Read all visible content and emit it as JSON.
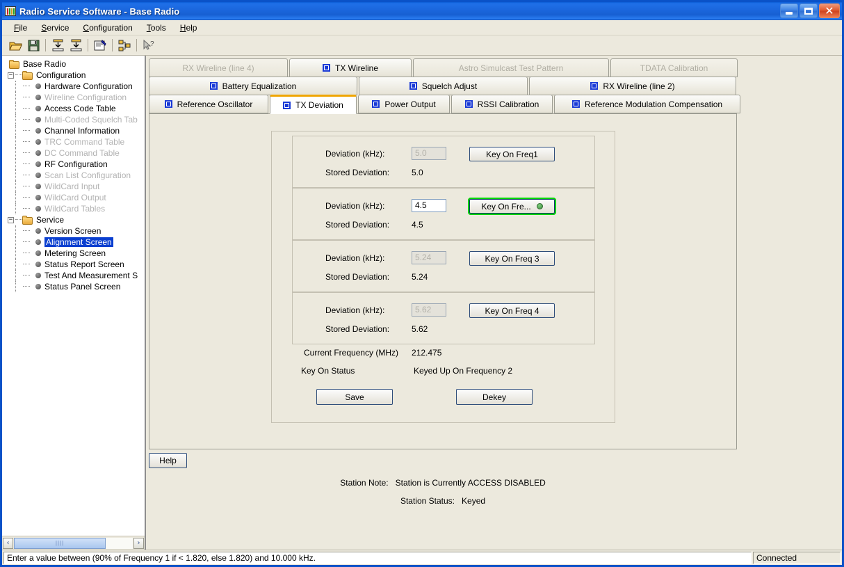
{
  "window": {
    "title": "Radio Service Software - Base Radio",
    "icon": "radio-icon",
    "minimize_label": "Minimize",
    "maximize_label": "Maximize",
    "close_label": "Close"
  },
  "menu": [
    {
      "label": "File",
      "accel": "F"
    },
    {
      "label": "Service",
      "accel": "S"
    },
    {
      "label": "Configuration",
      "accel": "C"
    },
    {
      "label": "Tools",
      "accel": "T"
    },
    {
      "label": "Help",
      "accel": "H"
    }
  ],
  "toolbar": [
    {
      "name": "open-icon",
      "title": "Open"
    },
    {
      "name": "save-icon",
      "title": "Save"
    },
    {
      "sep": true
    },
    {
      "name": "read-from-radio-icon",
      "title": "Read from radio"
    },
    {
      "name": "write-to-radio-icon",
      "title": "Write to radio"
    },
    {
      "sep": true
    },
    {
      "name": "report-icon",
      "title": "Report"
    },
    {
      "sep": true
    },
    {
      "name": "network-icon",
      "title": "Network"
    },
    {
      "sep": true
    },
    {
      "name": "help-pointer-icon",
      "title": "Context help"
    }
  ],
  "tree": {
    "root": {
      "label": "Base Radio",
      "icon": "folder-icon"
    },
    "nodes": [
      {
        "label": "Configuration",
        "type": "folder",
        "expanded": true,
        "depth": 1,
        "disabled": false
      },
      {
        "label": "Hardware Configuration",
        "type": "leaf",
        "depth": 2,
        "disabled": false
      },
      {
        "label": "Wireline Configuration",
        "type": "leaf",
        "depth": 2,
        "disabled": true
      },
      {
        "label": "Access Code Table",
        "type": "leaf",
        "depth": 2,
        "disabled": false
      },
      {
        "label": "Multi-Coded Squelch Tab",
        "type": "leaf",
        "depth": 2,
        "disabled": true
      },
      {
        "label": "Channel Information",
        "type": "leaf",
        "depth": 2,
        "disabled": false
      },
      {
        "label": "TRC Command Table",
        "type": "leaf",
        "depth": 2,
        "disabled": true
      },
      {
        "label": "DC Command Table",
        "type": "leaf",
        "depth": 2,
        "disabled": true
      },
      {
        "label": "RF Configuration",
        "type": "leaf",
        "depth": 2,
        "disabled": false
      },
      {
        "label": "Scan List Configuration",
        "type": "leaf",
        "depth": 2,
        "disabled": true
      },
      {
        "label": "WildCard Input",
        "type": "leaf",
        "depth": 2,
        "disabled": true
      },
      {
        "label": "WildCard Output",
        "type": "leaf",
        "depth": 2,
        "disabled": true
      },
      {
        "label": "WildCard Tables",
        "type": "leaf",
        "depth": 2,
        "disabled": true
      },
      {
        "label": "Service",
        "type": "folder",
        "expanded": true,
        "depth": 1,
        "disabled": false
      },
      {
        "label": "Version Screen",
        "type": "leaf",
        "depth": 2,
        "disabled": false
      },
      {
        "label": "Alignment Screen",
        "type": "leaf",
        "depth": 2,
        "disabled": false,
        "selected": true
      },
      {
        "label": "Metering Screen",
        "type": "leaf",
        "depth": 2,
        "disabled": false
      },
      {
        "label": "Status Report Screen",
        "type": "leaf",
        "depth": 2,
        "disabled": false
      },
      {
        "label": "Test And Measurement S",
        "type": "leaf",
        "depth": 2,
        "disabled": false
      },
      {
        "label": "Status Panel Screen",
        "type": "leaf",
        "depth": 2,
        "disabled": false
      }
    ]
  },
  "tabs": {
    "row1": [
      {
        "label": "RX Wireline (line 4)",
        "disabled": true,
        "active": false
      },
      {
        "label": "TX Wireline",
        "disabled": false,
        "active": false
      },
      {
        "label": "Astro Simulcast Test Pattern",
        "disabled": true,
        "active": false
      },
      {
        "label": "TDATA Calibration",
        "disabled": true,
        "active": false
      }
    ],
    "row2": [
      {
        "label": "Battery Equalization",
        "disabled": false,
        "active": false
      },
      {
        "label": "Squelch Adjust",
        "disabled": false,
        "active": false
      },
      {
        "label": "RX Wireline (line 2)",
        "disabled": false,
        "active": false
      }
    ],
    "row3": [
      {
        "label": "Reference Oscillator",
        "disabled": false,
        "active": false
      },
      {
        "label": "TX Deviation",
        "disabled": false,
        "active": true
      },
      {
        "label": "Power Output",
        "disabled": false,
        "active": false
      },
      {
        "label": "RSSI Calibration",
        "disabled": false,
        "active": false
      },
      {
        "label": "Reference Modulation Compensation",
        "disabled": false,
        "active": false
      }
    ]
  },
  "deviation_groups": [
    {
      "deviation_label": "Deviation (kHz):",
      "value": "5.0",
      "enabled": false,
      "stored_label": "Stored Deviation:",
      "stored_value": "5.0",
      "button_label": "Key On Freq1",
      "keyed": false
    },
    {
      "deviation_label": "Deviation (kHz):",
      "value": "4.5",
      "enabled": true,
      "stored_label": "Stored Deviation:",
      "stored_value": "4.5",
      "button_label": "Key On Fre...",
      "keyed": true
    },
    {
      "deviation_label": "Deviation (kHz):",
      "value": "5.24",
      "enabled": false,
      "stored_label": "Stored Deviation:",
      "stored_value": "5.24",
      "button_label": "Key On Freq 3",
      "keyed": false
    },
    {
      "deviation_label": "Deviation (kHz):",
      "value": "5.62",
      "enabled": false,
      "stored_label": "Stored Deviation:",
      "stored_value": "5.62",
      "button_label": "Key On Freq 4",
      "keyed": false
    }
  ],
  "readouts": {
    "current_frequency_label": "Current Frequency (MHz)",
    "current_frequency_value": "212.475",
    "key_on_status_label": "Key On Status",
    "key_on_status_value": "Keyed Up On Frequency 2"
  },
  "actions": {
    "save_label": "Save",
    "dekey_label": "Dekey",
    "help_label": "Help"
  },
  "station": {
    "note_label": "Station Note:",
    "note_value": "Station is Currently ACCESS DISABLED",
    "status_label": "Station Status:",
    "status_value": "Keyed"
  },
  "statusbar": {
    "message": "Enter a value between (90% of Frequency 1 if < 1.820, else 1.820) and 10.000 kHz.",
    "connection": "Connected"
  },
  "colors": {
    "titlebar": "#1b67de",
    "accent_tab": "#f0a500",
    "keyed_outline": "#00d400",
    "led": "#4a9a4a",
    "selection": "#0a3fd0",
    "panel_bg": "#ece9dd"
  }
}
